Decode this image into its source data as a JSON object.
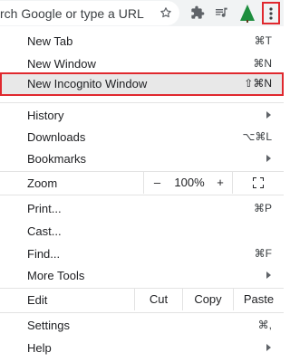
{
  "toolbar": {
    "omnibox_text": "rch Google or type a URL",
    "icons": [
      "star-icon",
      "puzzle-icon",
      "playlist-icon",
      "tree-icon",
      "more-vertical-icon"
    ]
  },
  "menu": {
    "new_tab": {
      "label": "New Tab",
      "shortcut": "⌘T"
    },
    "new_window": {
      "label": "New Window",
      "shortcut": "⌘N"
    },
    "new_incognito": {
      "label": "New Incognito Window",
      "shortcut": "⇧⌘N"
    },
    "history": {
      "label": "History"
    },
    "downloads": {
      "label": "Downloads",
      "shortcut": "⌥⌘L"
    },
    "bookmarks": {
      "label": "Bookmarks"
    },
    "zoom": {
      "label": "Zoom",
      "minus": "–",
      "value": "100%",
      "plus": "+"
    },
    "print": {
      "label": "Print...",
      "shortcut": "⌘P"
    },
    "cast": {
      "label": "Cast..."
    },
    "find": {
      "label": "Find...",
      "shortcut": "⌘F"
    },
    "more_tools": {
      "label": "More Tools"
    },
    "edit": {
      "label": "Edit",
      "cut": "Cut",
      "copy": "Copy",
      "paste": "Paste"
    },
    "settings": {
      "label": "Settings",
      "shortcut": "⌘,"
    },
    "help": {
      "label": "Help"
    }
  },
  "colors": {
    "highlight_border": "#e0282e",
    "tree": "#1e8e3e"
  }
}
